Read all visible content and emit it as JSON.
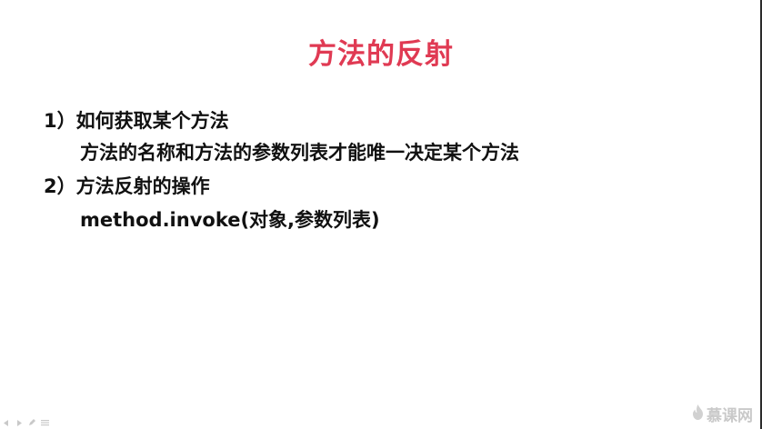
{
  "slide": {
    "title": "方法的反射",
    "lines": [
      "1）如何获取某个方法",
      "方法的名称和方法的参数列表才能唯一决定某个方法",
      "2）方法反射的操作",
      "method.invoke(对象,参数列表)"
    ]
  },
  "watermark": {
    "text": "慕课网",
    "icon": "flame-logo-icon"
  },
  "colors": {
    "title": "#e03a53",
    "body_text": "#111111",
    "background": "#ffffff"
  }
}
